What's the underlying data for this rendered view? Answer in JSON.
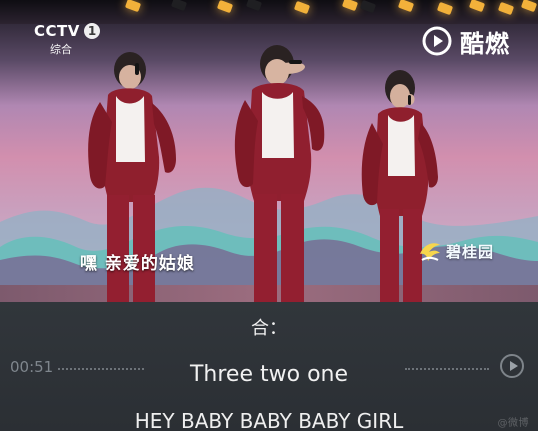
{
  "video": {
    "channel": {
      "name": "CCTV",
      "number": "1",
      "subtitle": "综合"
    },
    "brand_overlay": {
      "name": "酷燃"
    },
    "subtitle": "嘿 亲爱的姑娘",
    "sponsor": {
      "name": "碧桂园"
    }
  },
  "player": {
    "time": "00:51",
    "lyrics": [
      "合：",
      "Three two one",
      "HEY BABY BABY BABY GIRL"
    ],
    "watermark": "@微博"
  },
  "icons": {
    "kuran_logo": "kuran-logo-icon",
    "sponsor_logo": "sponsor-logo-icon",
    "play_button": "play-circle-icon"
  },
  "colors": {
    "panel_background": "#2f3338",
    "lyric_text": "#f1f1f1",
    "secondary_text": "#7f868d",
    "accent_red": "#8f1f2d"
  }
}
